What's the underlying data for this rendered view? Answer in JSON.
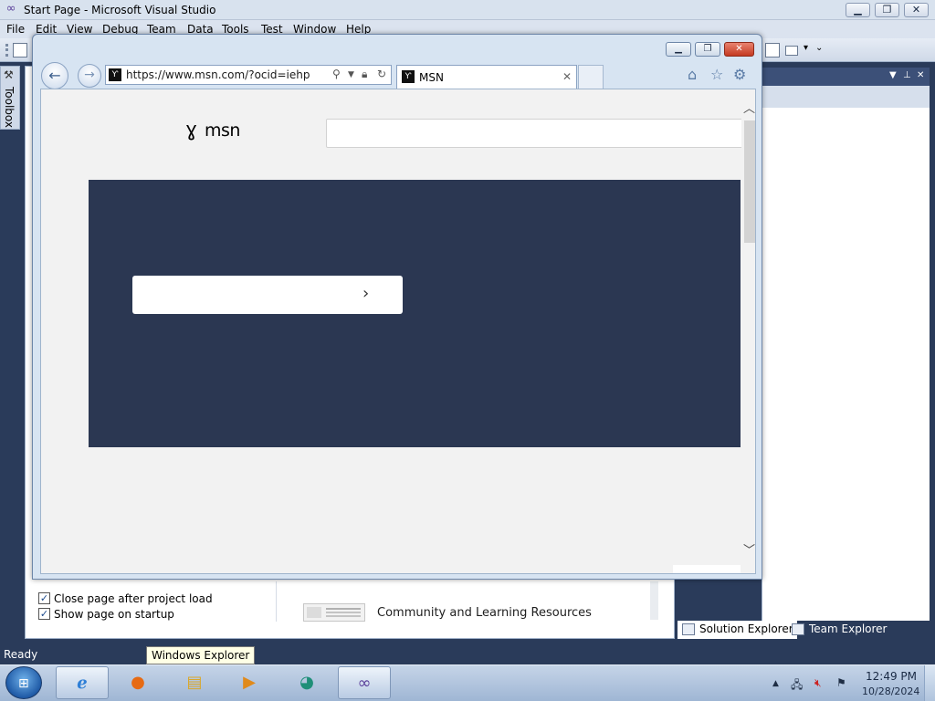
{
  "vs": {
    "title": "Start Page - Microsoft Visual Studio",
    "menu": [
      "File",
      "Edit",
      "View",
      "Debug",
      "Team",
      "Data",
      "Tools",
      "Test",
      "Window",
      "Help"
    ],
    "toolbox_label": "Toolbox",
    "startpage": {
      "close_after_load": "Close page after project load",
      "show_on_startup": "Show page on startup",
      "community": "Community and Learning Resources"
    },
    "solution_tabs": [
      "Solution Explorer",
      "Team Explorer"
    ],
    "status": "Ready",
    "tooltip": "Windows Explorer"
  },
  "ie": {
    "url": "https://www.msn.com/?ocid=iehp",
    "tab_title": "MSN",
    "msn_logo_text": "msn"
  },
  "taskbar": {
    "time": "12:49 PM",
    "date": "10/28/2024"
  },
  "icons": [
    "visual-studio-logo-icon",
    "back-arrow-icon",
    "forward-arrow-icon",
    "msn-butterfly-icon",
    "search-icon",
    "lock-icon",
    "refresh-icon",
    "home-icon",
    "favorites-star-icon",
    "settings-gear-icon",
    "close-icon",
    "chevron-right-icon",
    "windows-start-icon",
    "internet-explorer-icon",
    "firefox-icon",
    "folder-icon",
    "media-player-icon",
    "edge-icon",
    "volume-muted-icon",
    "network-icon",
    "action-center-flag-icon"
  ]
}
